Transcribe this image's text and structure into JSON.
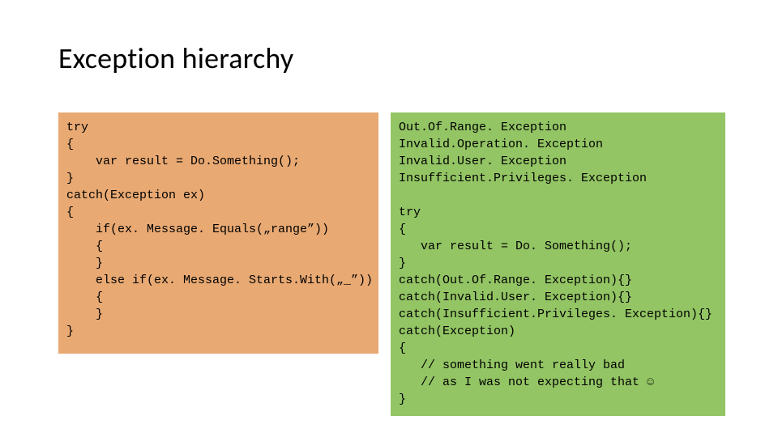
{
  "title": "Exception hierarchy",
  "left_code": "try\n{\n    var result = Do.Something();\n}\ncatch(Exception ex)\n{\n    if(ex. Message. Equals(„range”))\n    {\n    }\n    else if(ex. Message. Starts.With(„_”))\n    {\n    }\n}",
  "right_code": "Out.Of.Range. Exception\nInvalid.Operation. Exception\nInvalid.User. Exception\nInsufficient.Privileges. Exception\n\ntry\n{\n   var result = Do. Something();\n}\ncatch(Out.Of.Range. Exception){}\ncatch(Invalid.User. Exception){}\ncatch(Insufficient.Privileges. Exception){}\ncatch(Exception)\n{\n   // something went really bad\n   // as I was not expecting that ☺\n}"
}
